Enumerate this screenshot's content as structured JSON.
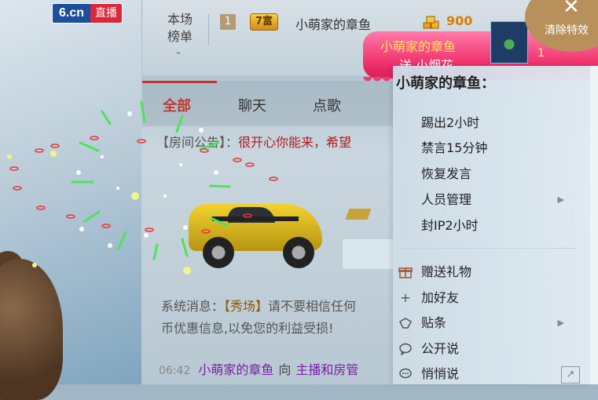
{
  "logo": {
    "mark": "6.cn",
    "live": "直播"
  },
  "ranking": {
    "tab_label_line1": "本场",
    "tab_label_line2": "榜单",
    "rank_number": "1",
    "wealth_level": "7富",
    "top_user": "小萌家的章鱼",
    "coins": "900"
  },
  "clear_effects": {
    "label": "清除特效"
  },
  "gift_banner": {
    "sender": "小萌家的章鱼",
    "action": "送 小烟花",
    "count": "1"
  },
  "tabs": [
    {
      "label": "全部",
      "active": true
    },
    {
      "label": "聊天",
      "active": false
    },
    {
      "label": "点歌",
      "active": false
    }
  ],
  "notice": {
    "label": "【房间公告】：",
    "text": "很开心你能来，希望"
  },
  "system_message": {
    "prefix": "系统消息：",
    "tag": "【秀场】",
    "text": "请不要相信任何",
    "text_line2": "币优惠信息,以免您的利益受损!"
  },
  "chat": {
    "time": "06:42",
    "user": "小萌家的章鱼",
    "verb": "向",
    "target": "主播和房管"
  },
  "context_menu": {
    "title": "小萌家的章鱼：",
    "admin_items": [
      "踢出2小时",
      "禁言15分钟",
      "恢复发言",
      "人员管理",
      "封IP2小时"
    ],
    "social_items": [
      {
        "label": "赠送礼物",
        "icon": "gift-icon"
      },
      {
        "label": "加好友",
        "icon": "plus-icon"
      },
      {
        "label": "贴条",
        "icon": "tag-icon"
      },
      {
        "label": "公开说",
        "icon": "speech-bubble-icon"
      },
      {
        "label": "悄悄说",
        "icon": "whisper-icon"
      }
    ]
  },
  "colors": {
    "accent_red": "#c0392b",
    "coin_orange": "#e07b00",
    "banner_pink": "#ef2f6a",
    "username_purple": "#7a1fa2"
  }
}
